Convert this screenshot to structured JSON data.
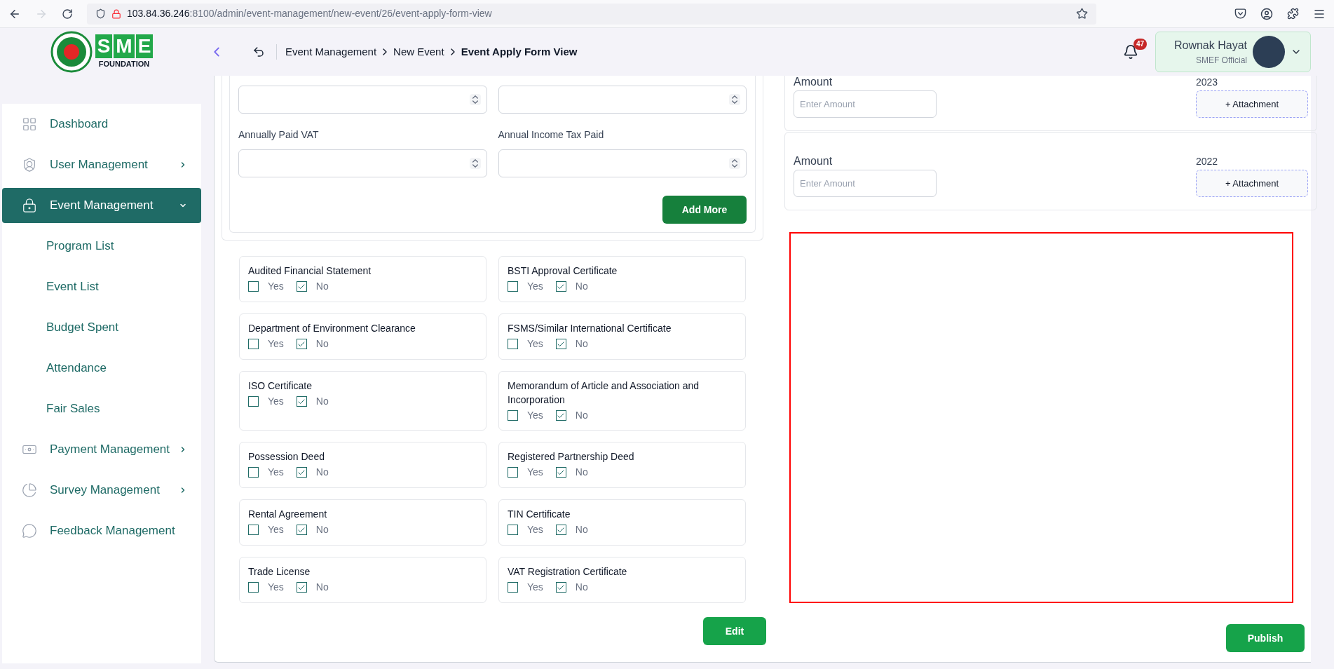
{
  "browser": {
    "url_host": "103.84.36.246",
    "url_path": ":8100/admin/event-management/new-event/26/event-apply-form-view",
    "forward_disabled": true
  },
  "header": {
    "logo": {
      "letters": "SME",
      "subtitle": "FOUNDATION"
    },
    "breadcrumb": [
      "Event Management",
      "New Event",
      "Event Apply Form View"
    ],
    "notifications": "47",
    "user": {
      "name": "Rownak Hayat",
      "role": "SMEF Official"
    }
  },
  "sidebar": {
    "items": [
      {
        "label": "Dashboard",
        "kind": "link",
        "selected": false
      },
      {
        "label": "User Management",
        "kind": "menu",
        "expanded": false,
        "selected": false
      },
      {
        "label": "Event Management",
        "kind": "menu",
        "expanded": true,
        "selected": true,
        "children": [
          {
            "label": "Program List",
            "selected": false
          },
          {
            "label": "Event List",
            "selected": false
          },
          {
            "label": "Budget Spent",
            "selected": false
          },
          {
            "label": "Attendance",
            "selected": false
          },
          {
            "label": "Fair Sales",
            "selected": false
          }
        ]
      },
      {
        "label": "Payment Management",
        "kind": "menu",
        "expanded": false,
        "selected": false
      },
      {
        "label": "Survey Management",
        "kind": "menu",
        "expanded": false,
        "selected": false
      },
      {
        "label": "Feedback Management",
        "kind": "link",
        "selected": false
      }
    ]
  },
  "financial_fields": [
    {
      "kind": "number"
    },
    {
      "kind": "number"
    },
    {
      "kind": "number",
      "label": "Annually Paid VAT"
    },
    {
      "kind": "number",
      "label": "Annual Income Tax Paid"
    }
  ],
  "add_more": "Add More",
  "documents": [
    {
      "label": "Audited Financial Statement",
      "options": [
        {
          "label": "Yes",
          "checked": false
        },
        {
          "label": "No",
          "checked": true
        }
      ]
    },
    {
      "label": "BSTI Approval Certificate",
      "options": [
        {
          "label": "Yes",
          "checked": false
        },
        {
          "label": "No",
          "checked": true
        }
      ]
    },
    {
      "label": "Department of Environment Clearance",
      "options": [
        {
          "label": "Yes",
          "checked": false
        },
        {
          "label": "No",
          "checked": true
        }
      ]
    },
    {
      "label": "FSMS/Similar International Certificate",
      "options": [
        {
          "label": "Yes",
          "checked": false
        },
        {
          "label": "No",
          "checked": true
        }
      ]
    },
    {
      "label": "ISO Certificate",
      "options": [
        {
          "label": "Yes",
          "checked": false
        },
        {
          "label": "No",
          "checked": true
        }
      ]
    },
    {
      "label": "Memorandum of Article and Association and Incorporation",
      "options": [
        {
          "label": "Yes",
          "checked": false
        },
        {
          "label": "No",
          "checked": true
        }
      ]
    },
    {
      "label": "Possession Deed",
      "options": [
        {
          "label": "Yes",
          "checked": false
        },
        {
          "label": "No",
          "checked": true
        }
      ]
    },
    {
      "label": "Registered Partnership Deed",
      "options": [
        {
          "label": "Yes",
          "checked": false
        },
        {
          "label": "No",
          "checked": true
        }
      ]
    },
    {
      "label": "Rental Agreement",
      "options": [
        {
          "label": "Yes",
          "checked": false
        },
        {
          "label": "No",
          "checked": true
        }
      ]
    },
    {
      "label": "TIN Certificate",
      "options": [
        {
          "label": "Yes",
          "checked": false
        },
        {
          "label": "No",
          "checked": true
        }
      ]
    },
    {
      "label": "Trade License",
      "options": [
        {
          "label": "Yes",
          "checked": false
        },
        {
          "label": "No",
          "checked": true
        }
      ]
    },
    {
      "label": "VAT Registration Certificate",
      "options": [
        {
          "label": "Yes",
          "checked": false
        },
        {
          "label": "No",
          "checked": true
        }
      ]
    }
  ],
  "amounts": [
    {
      "label": "Amount",
      "placeholder": "Enter Amount",
      "year": "2023",
      "attachment": "+ Attachment"
    },
    {
      "label": "Amount",
      "placeholder": "Enter Amount",
      "year": "2022",
      "attachment": "+ Attachment"
    }
  ],
  "edit_button": "Edit",
  "publish_button": "Publish"
}
